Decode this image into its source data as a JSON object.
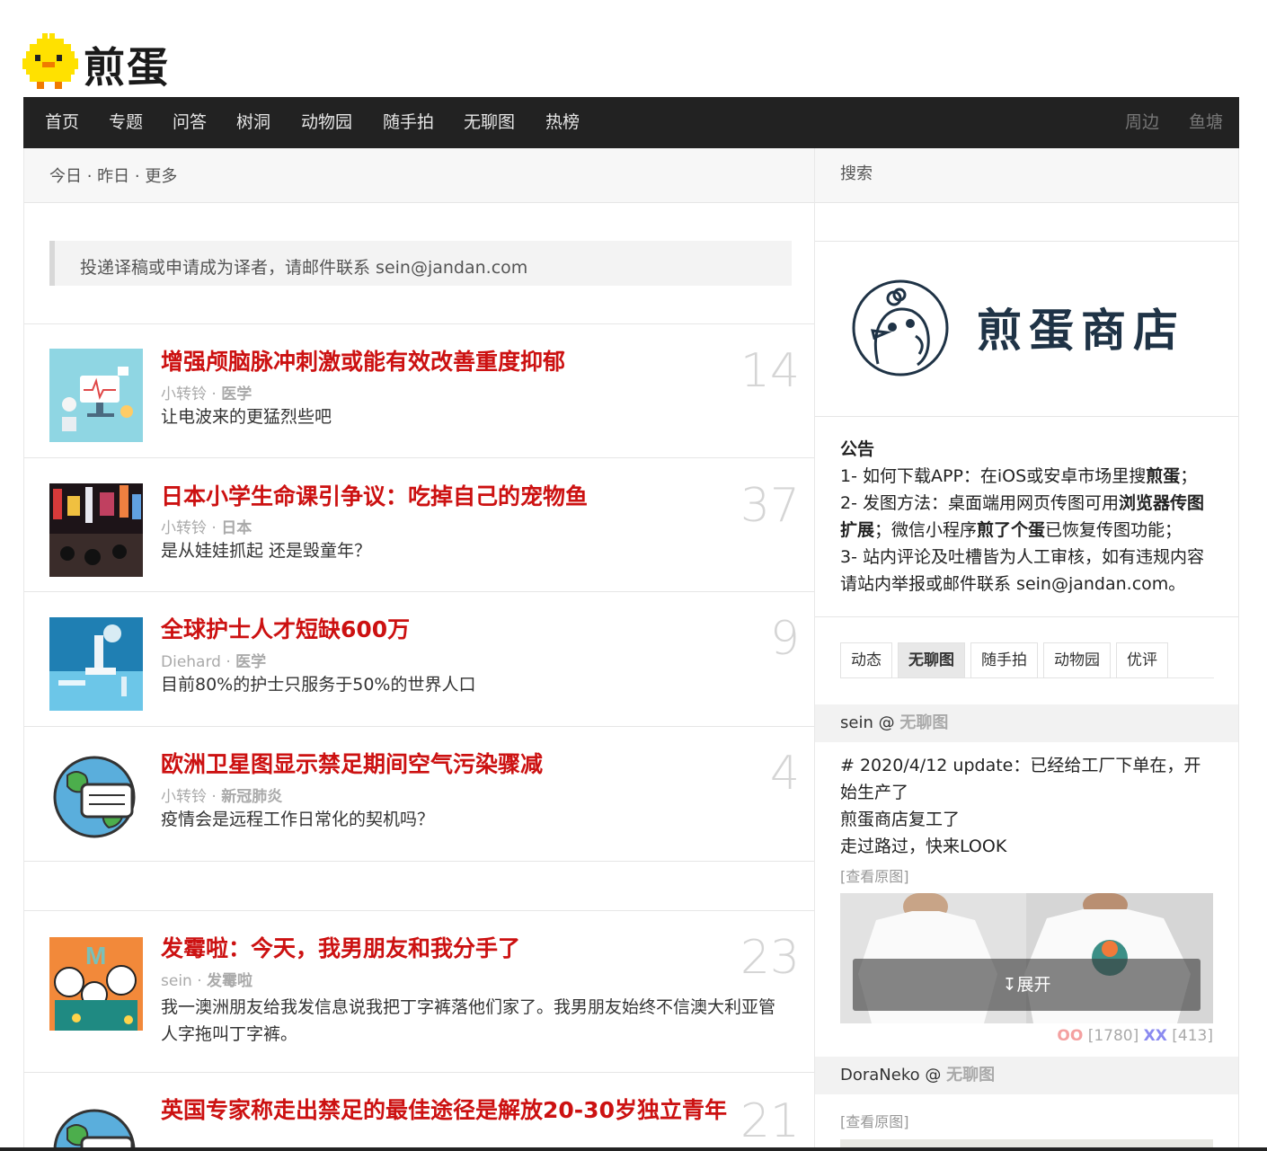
{
  "site": {
    "logo_text": "煎蛋"
  },
  "nav": {
    "left": [
      "首页",
      "专题",
      "问答",
      "树洞",
      "动物园",
      "随手拍",
      "无聊图",
      "热榜"
    ],
    "right": [
      "周边",
      "鱼塘"
    ]
  },
  "datebar": {
    "text": "今日 · 昨日 · 更多"
  },
  "notice": {
    "text": "投递译稿或申请成为译者，请邮件联系 sein@jandan.com"
  },
  "posts": [
    {
      "title": "增强颅脑脉冲刺激或能有效改善重度抑郁",
      "author": "小转铃",
      "sep": " · ",
      "tag": "医学",
      "excerpt": "让电波来的更猛烈些吧",
      "count": "14"
    },
    {
      "title": "日本小学生命课引争议：吃掉自己的宠物鱼",
      "author": "小转铃",
      "sep": " · ",
      "tag": "日本",
      "excerpt": "是从娃娃抓起 还是毁童年？",
      "count": "37"
    },
    {
      "title": "全球护士人才短缺600万",
      "author": "Diehard",
      "sep": " · ",
      "tag": "医学",
      "excerpt": "目前80%的护士只服务于50%的世界人口",
      "count": "9"
    },
    {
      "title": "欧洲卫星图显示禁足期间空气污染骤减",
      "author": "小转铃",
      "sep": " · ",
      "tag": "新冠肺炎",
      "excerpt": "疫情会是远程工作日常化的契机吗？",
      "count": "4"
    },
    {
      "title": "发霉啦：今天，我男朋友和我分手了",
      "author": "sein",
      "sep": " · ",
      "tag": "发霉啦",
      "excerpt": "我一澳洲朋友给我发信息说我把丁字裤落他们家了。我男朋友始终不信澳大利亚管人字拖叫丁字裤。",
      "count": "23"
    },
    {
      "title": "英国专家称走出禁足的最佳途径是解放20-30岁独立青年",
      "author": "",
      "sep": "",
      "tag": "",
      "excerpt": "",
      "count": "21"
    }
  ],
  "sidebar": {
    "search_label": "搜索",
    "shop_text": "煎蛋商店",
    "announcement": {
      "heading": "公告",
      "line1_a": "1- 如何下载APP：在iOS或安卓市场里搜",
      "line1_b": "煎蛋",
      "line1_c": "；",
      "line2_a": "2- 发图方法：桌面端用网页传图可用",
      "line2_b": "浏览器传图扩展",
      "line2_c": "；微信小程序",
      "line2_d": "煎了个蛋",
      "line2_e": "已恢复传图功能；",
      "line3": "3- 站内评论及吐槽皆为人工审核，如有违规内容请站内举报或邮件联系 sein@jandan.com。"
    },
    "tabs": [
      "动态",
      "无聊图",
      "随手拍",
      "动物园",
      "优评"
    ],
    "active_tab": "无聊图",
    "comments": [
      {
        "user": "sein",
        "at": " @ ",
        "category": "无聊图",
        "lines": [
          "# 2020/4/12 update：已经给工厂下单在，开始生产了",
          "煎蛋商店复工了",
          "走过路过，快来LOOK"
        ],
        "view_original": "[查看原图]",
        "expand": "↧展开",
        "oo_label": "OO",
        "oo_count": "[1780]",
        "xx_label": "XX",
        "xx_count": "[413]"
      },
      {
        "user": "DoraNeko",
        "at": " @ ",
        "category": "无聊图",
        "view_original": "[查看原图]"
      }
    ]
  },
  "colors": {
    "accent_red": "#cc1111",
    "nav_bg": "#222222",
    "shop_navy": "#1f3346"
  }
}
